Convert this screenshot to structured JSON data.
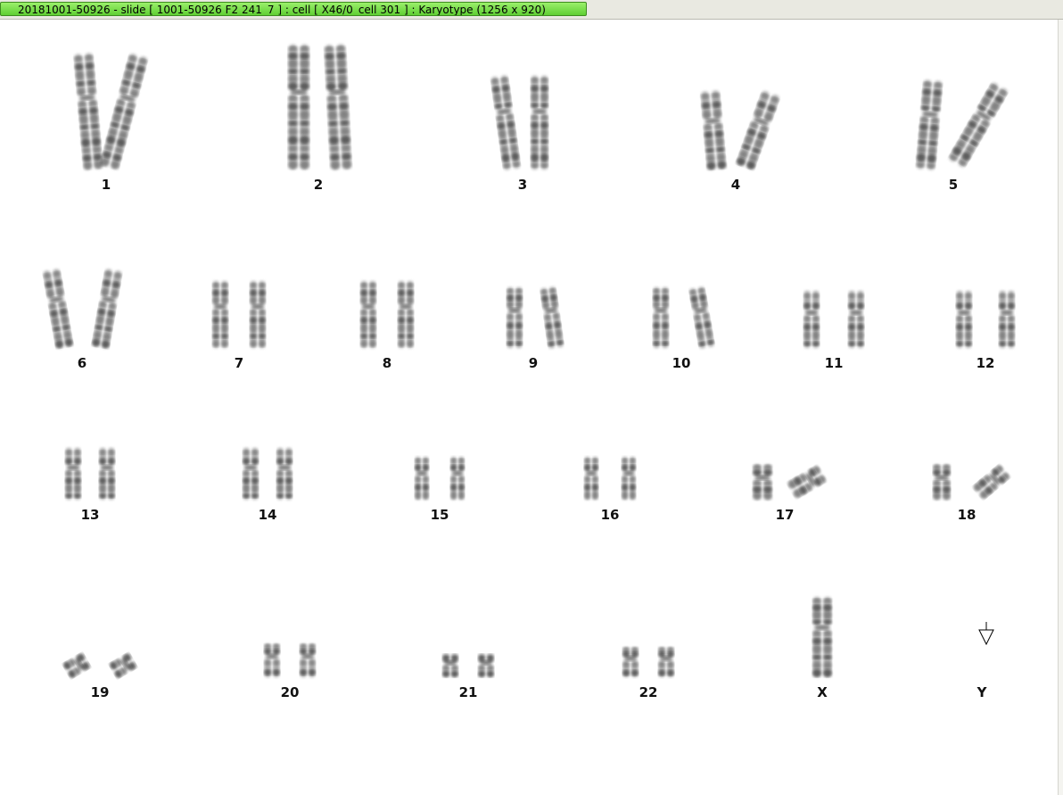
{
  "window": {
    "title": "20181001-50926 - slide [ 1001-50926 F2 241_7 ] : cell [ X46/0_cell 301 ] : Karyotype  (1256 x 920)"
  },
  "karyotype": {
    "chromosomes": [
      {
        "label": "1"
      },
      {
        "label": "2"
      },
      {
        "label": "3"
      },
      {
        "label": "4"
      },
      {
        "label": "5"
      },
      {
        "label": "6"
      },
      {
        "label": "7"
      },
      {
        "label": "8"
      },
      {
        "label": "9"
      },
      {
        "label": "10"
      },
      {
        "label": "11"
      },
      {
        "label": "12"
      },
      {
        "label": "13"
      },
      {
        "label": "14"
      },
      {
        "label": "15"
      },
      {
        "label": "16"
      },
      {
        "label": "17"
      },
      {
        "label": "18"
      },
      {
        "label": "19"
      },
      {
        "label": "20"
      },
      {
        "label": "21"
      },
      {
        "label": "22"
      },
      {
        "label": "X"
      },
      {
        "label": "Y"
      }
    ]
  },
  "icons": {
    "cursor": "arrow-cursor-icon"
  }
}
